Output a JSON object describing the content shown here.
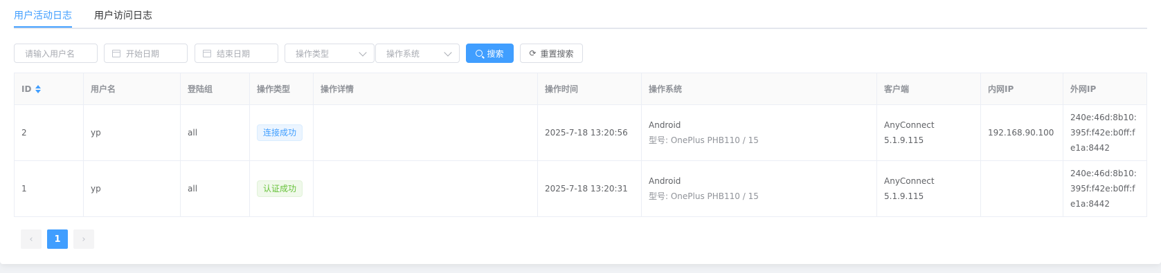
{
  "tabs": [
    {
      "label": "用户活动日志",
      "active": true
    },
    {
      "label": "用户访问日志",
      "active": false
    }
  ],
  "filters": {
    "username_placeholder": "请输入用户名",
    "start_date_placeholder": "开始日期",
    "end_date_placeholder": "结束日期",
    "op_type_placeholder": "操作类型",
    "os_placeholder": "操作系统",
    "search_label": "搜索",
    "reset_label": "重置搜索"
  },
  "table": {
    "columns": [
      "ID",
      "用户名",
      "登陆组",
      "操作类型",
      "操作详情",
      "操作时间",
      "操作系统",
      "客户端",
      "内网IP",
      "外网IP"
    ],
    "rows": [
      {
        "id": "2",
        "username": "yp",
        "group": "all",
        "op_type": "连接成功",
        "detail": "",
        "time": "2025-7-18 13:20:56",
        "os": "Android",
        "os_model_label": "型号: ",
        "os_model": "OnePlus PHB110 / 15",
        "client": "AnyConnect 5.1.9.115",
        "lan_ip": "192.168.90.100",
        "wan_ip": "240e:46d:8b10:395f:f42e:b0ff:fe1a:8442"
      },
      {
        "id": "1",
        "username": "yp",
        "group": "all",
        "op_type": "认证成功",
        "detail": "",
        "time": "2025-7-18 13:20:31",
        "os": "Android",
        "os_model_label": "型号: ",
        "os_model": "OnePlus PHB110 / 15",
        "client": "AnyConnect 5.1.9.115",
        "lan_ip": "",
        "wan_ip": "240e:46d:8b10:395f:f42e:b0ff:fe1a:8442"
      }
    ]
  },
  "pagination": {
    "current_page": "1",
    "prev_icon": "chevron-left-icon",
    "next_icon": "chevron-right-icon"
  },
  "colors": {
    "accent": "#409eff",
    "success": "#67c23a"
  }
}
